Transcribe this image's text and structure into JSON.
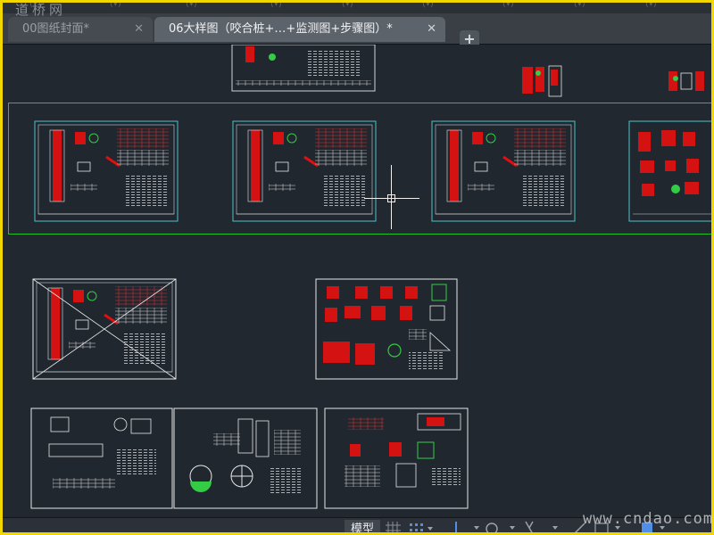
{
  "watermark_top": "道桥网",
  "tabs": [
    {
      "label": "00图纸封面*",
      "close": "✕",
      "active": false
    },
    {
      "label": "06大样图（咬合桩+…+监测图+步骤图）*",
      "close": "✕",
      "active": true
    }
  ],
  "add_tab": "+",
  "canvas": {
    "drawing_sheets_count": 13,
    "selected_row_sheets": 4
  },
  "statusbar": {
    "model_tab": "模型",
    "grid_icon": "grid-icon",
    "snap_icon": "snap-icon"
  },
  "watermark": "www.cndao.com",
  "colors": {
    "frame_border": "#f2d600",
    "canvas_bg": "#212830",
    "selection_box": "#22c32b",
    "sheet_border": "#e8e8e8",
    "drawing_red": "#e01010"
  }
}
